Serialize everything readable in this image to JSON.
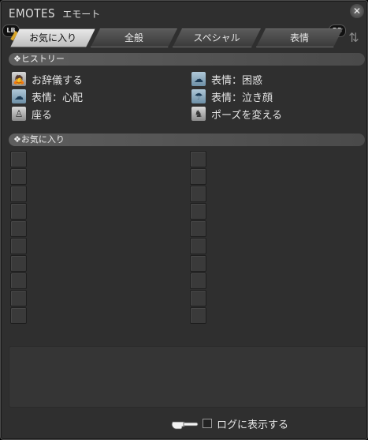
{
  "window": {
    "title": "EMOTES",
    "title_sub": "エモート",
    "close_icon": "close-x-icon"
  },
  "gamepad": {
    "lb": "LB",
    "rb": "RB"
  },
  "tabs": [
    {
      "label": "お気に入り",
      "active": true
    },
    {
      "label": "全般",
      "active": false
    },
    {
      "label": "スペシャル",
      "active": false
    },
    {
      "label": "表情",
      "active": false
    }
  ],
  "history": {
    "header": "❖ヒストリー",
    "items": [
      {
        "label": "お辞儀する",
        "icon": "bow-icon"
      },
      {
        "label": "表情：困惑",
        "icon": "puzzled-face-icon"
      },
      {
        "label": "表情：心配",
        "icon": "worried-face-icon"
      },
      {
        "label": "表情：泣き顔",
        "icon": "crying-face-icon"
      },
      {
        "label": "座る",
        "icon": "sit-icon"
      },
      {
        "label": "ポーズを変える",
        "icon": "change-pose-icon"
      }
    ]
  },
  "favorites": {
    "header": "❖お気に入り",
    "slots_per_column": 10
  },
  "footer": {
    "log_label": "ログに表示する",
    "log_checked": false
  }
}
